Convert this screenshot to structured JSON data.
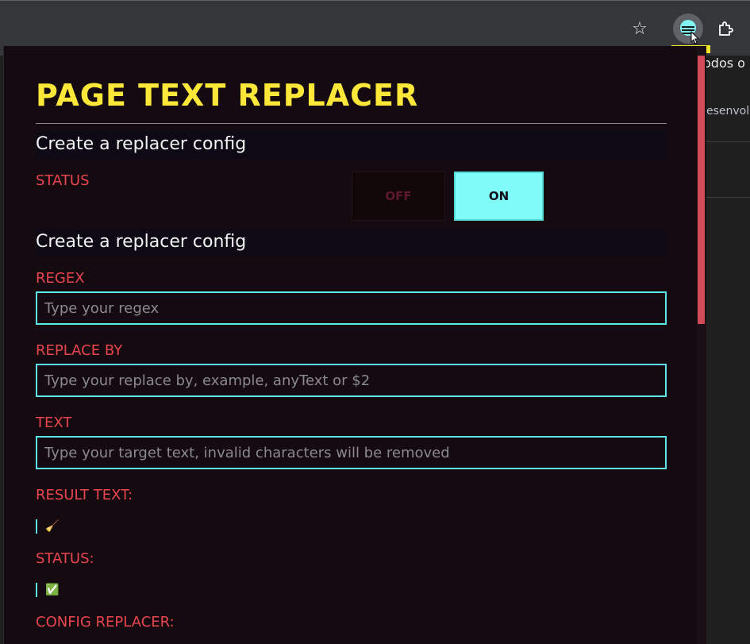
{
  "browser": {
    "star_icon": "star-icon",
    "extension_icon": "page-text-replacer-icon",
    "puzzle_icon": "extensions-puzzle-icon",
    "bg_text_1": "odos o",
    "bg_text_2": "esenvol"
  },
  "popup": {
    "title": "PAGE TEXT REPLACER",
    "section1_heading": "Create a replacer config",
    "status_label": "STATUS",
    "toggle_off": "OFF",
    "toggle_on": "ON",
    "toggle_state": "ON",
    "section2_heading": "Create a replacer config",
    "regex_label": "REGEX",
    "regex_placeholder": "Type your regex",
    "replace_label": "REPLACE BY",
    "replace_placeholder": "Type your replace by, example, anyText or $2",
    "text_label": "TEXT",
    "text_placeholder": "Type your target text, invalid characters will be removed",
    "result_label": "RESULT TEXT:",
    "result_value": "🧹",
    "status2_label": "STATUS:",
    "status2_value": "✅",
    "config_label": "CONFIG REPLACER:"
  },
  "colors": {
    "title": "#fde83a",
    "label": "#e8454f",
    "accent": "#7ffcf8",
    "background": "#140a10",
    "scrollbar": "#d24b59"
  }
}
